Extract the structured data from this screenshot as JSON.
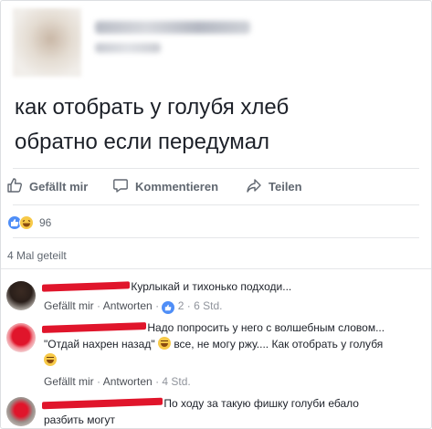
{
  "post": {
    "text_line1": "как отобрать у голубя хлеб",
    "text_line2": "обратно если передумал"
  },
  "actions": {
    "like": "Gefällt mir",
    "comment": "Kommentieren",
    "share": "Teilen"
  },
  "reactions": {
    "count": "96"
  },
  "shares": {
    "label": "4 Mal geteilt"
  },
  "comments": [
    {
      "text": "Курлыкай и тихонько подходи...",
      "like_label": "Gefällt mir",
      "reply_label": "Antworten",
      "likes": "2",
      "time": "6 Std."
    },
    {
      "text_line1": "Надо попросить у него с волшебным словом...",
      "text_line2a": "\"Отдай нахрен назад\"",
      "text_line2b": "все, не могу ржу.... Как отобрать у голубя",
      "like_label": "Gefällt mir",
      "reply_label": "Antworten",
      "time": "4 Std."
    },
    {
      "text_line1": "По ходу за такую фишку голуби ебало",
      "text_line2": "разбить могут"
    }
  ],
  "colors": {
    "link": "#385898",
    "redaction": "#e0152b",
    "like_blue": "#4f8ef7",
    "haha_yellow": "#f7c948"
  }
}
